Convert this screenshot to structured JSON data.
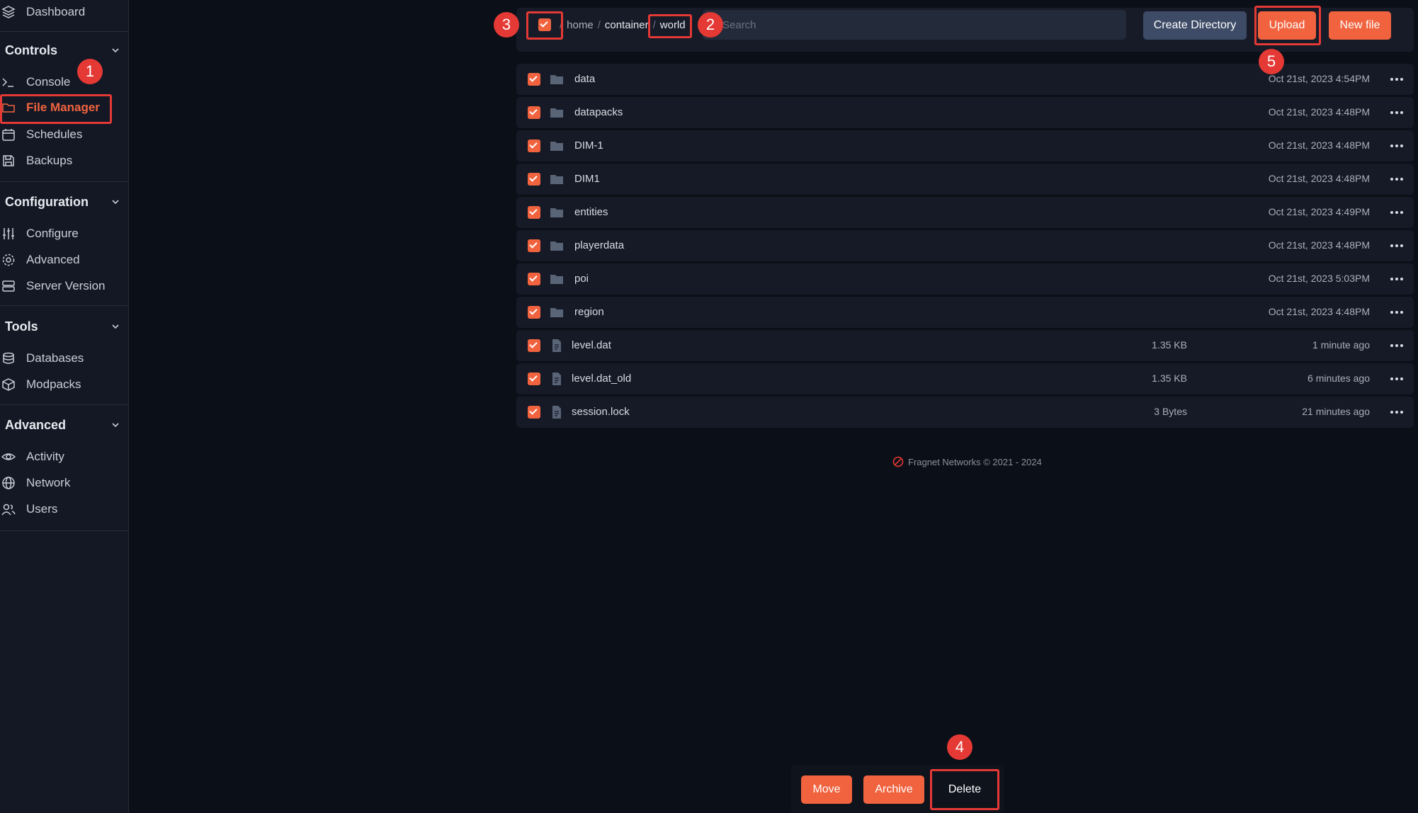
{
  "sidebar": {
    "top_item": {
      "label": "Dashboard",
      "icon": "layers-icon"
    },
    "sections": [
      {
        "title": "Controls",
        "items": [
          {
            "label": "Console",
            "icon": "terminal-icon"
          },
          {
            "label": "File Manager",
            "icon": "folder-icon",
            "active": true
          },
          {
            "label": "Schedules",
            "icon": "calendar-icon"
          },
          {
            "label": "Backups",
            "icon": "save-icon"
          }
        ]
      },
      {
        "title": "Configuration",
        "items": [
          {
            "label": "Configure",
            "icon": "sliders-icon"
          },
          {
            "label": "Advanced",
            "icon": "gear-icon"
          },
          {
            "label": "Server Version",
            "icon": "server-icon"
          }
        ]
      },
      {
        "title": "Tools",
        "items": [
          {
            "label": "Databases",
            "icon": "database-icon"
          },
          {
            "label": "Modpacks",
            "icon": "box-icon"
          }
        ]
      },
      {
        "title": "Advanced",
        "items": [
          {
            "label": "Activity",
            "icon": "eye-icon"
          },
          {
            "label": "Network",
            "icon": "globe-icon"
          },
          {
            "label": "Users",
            "icon": "users-icon"
          }
        ]
      }
    ]
  },
  "toolbar": {
    "breadcrumb": [
      "home",
      "container",
      "world"
    ],
    "search_placeholder": "Search",
    "create_dir_label": "Create Directory",
    "upload_label": "Upload",
    "new_file_label": "New file"
  },
  "files": [
    {
      "name": "data",
      "type": "folder",
      "size": "",
      "date": "Oct 21st, 2023 4:54PM"
    },
    {
      "name": "datapacks",
      "type": "folder",
      "size": "",
      "date": "Oct 21st, 2023 4:48PM"
    },
    {
      "name": "DIM-1",
      "type": "folder",
      "size": "",
      "date": "Oct 21st, 2023 4:48PM"
    },
    {
      "name": "DIM1",
      "type": "folder",
      "size": "",
      "date": "Oct 21st, 2023 4:48PM"
    },
    {
      "name": "entities",
      "type": "folder",
      "size": "",
      "date": "Oct 21st, 2023 4:49PM"
    },
    {
      "name": "playerdata",
      "type": "folder",
      "size": "",
      "date": "Oct 21st, 2023 4:48PM"
    },
    {
      "name": "poi",
      "type": "folder",
      "size": "",
      "date": "Oct 21st, 2023 5:03PM"
    },
    {
      "name": "region",
      "type": "folder",
      "size": "",
      "date": "Oct 21st, 2023 4:48PM"
    },
    {
      "name": "level.dat",
      "type": "file",
      "size": "1.35 KB",
      "date": "1 minute ago"
    },
    {
      "name": "level.dat_old",
      "type": "file",
      "size": "1.35 KB",
      "date": "6 minutes ago"
    },
    {
      "name": "session.lock",
      "type": "file",
      "size": "3 Bytes",
      "date": "21 minutes ago"
    }
  ],
  "footer": {
    "text": "Fragnet Networks © 2021 - 2024"
  },
  "actions": {
    "move_label": "Move",
    "archive_label": "Archive",
    "delete_label": "Delete"
  },
  "annotations": {
    "b1": "1",
    "b2": "2",
    "b3": "3",
    "b4": "4",
    "b5": "5"
  },
  "colors": {
    "accent": "#f1633f",
    "highlight": "#e53935",
    "background": "#0b0f18",
    "sidebar": "#131824"
  }
}
